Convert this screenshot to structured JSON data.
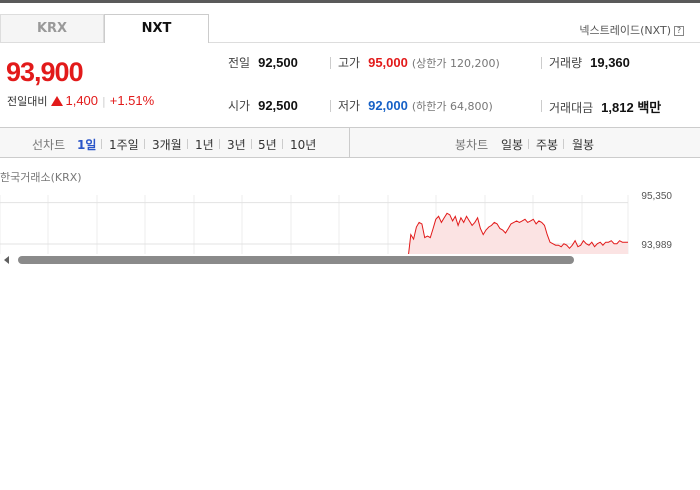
{
  "tabs": [
    {
      "label": "KRX",
      "active": false
    },
    {
      "label": "NXT",
      "active": true
    }
  ],
  "market_name": "넥스트레이드(NXT)",
  "help_glyph": "?",
  "price": "93,900",
  "change": {
    "label": "전일대비",
    "value": "1,400",
    "rate": "+1.51%",
    "direction": "up"
  },
  "stats": {
    "prev_close": {
      "label": "전일",
      "value": "92,500"
    },
    "high": {
      "label": "고가",
      "value": "95,000",
      "limit_text": "(상한가 120,200)"
    },
    "volume": {
      "label": "거래량",
      "value": "19,360"
    },
    "open": {
      "label": "시가",
      "value": "92,500"
    },
    "low": {
      "label": "저가",
      "value": "92,000",
      "limit_text": "(하한가 64,800)"
    },
    "amount": {
      "label": "거래대금",
      "value": "1,812 백만"
    }
  },
  "line_chart": {
    "label": "선차트",
    "periods": [
      {
        "label": "1일",
        "active": true
      },
      {
        "label": "1주일",
        "active": false
      },
      {
        "label": "3개월",
        "active": false
      },
      {
        "label": "1년",
        "active": false
      },
      {
        "label": "3년",
        "active": false
      },
      {
        "label": "5년",
        "active": false
      },
      {
        "label": "10년",
        "active": false
      }
    ]
  },
  "candle_chart": {
    "label": "봉차트",
    "periods": [
      {
        "label": "일봉",
        "active": false
      },
      {
        "label": "주봉",
        "active": false
      },
      {
        "label": "월봉",
        "active": false
      }
    ]
  },
  "chart_source": "한국거래소(KRX)",
  "chart_data": {
    "type": "line",
    "y_ticks": [
      "95,350",
      "93,989"
    ],
    "ylim": [
      93300,
      95600
    ],
    "line_color": "#e21a1a",
    "fill_color": "#fbe3e3",
    "values": [
      93500,
      94300,
      94150,
      94550,
      94700,
      94650,
      94200,
      94250,
      94200,
      94500,
      94800,
      94900,
      94700,
      94850,
      95000,
      94950,
      94750,
      94900,
      94600,
      94850,
      94700,
      94900,
      94750,
      94600,
      94700,
      94850,
      94500,
      94300,
      94450,
      94550,
      94600,
      94700,
      94650,
      94500,
      94450,
      94350,
      94500,
      94650,
      94700,
      94750,
      94700,
      94750,
      94800,
      94700,
      94750,
      94800,
      94650,
      94750,
      94700,
      94600,
      94300,
      94050,
      94000,
      93950,
      93950,
      93900,
      94000,
      93950,
      93850,
      93950,
      94100,
      93900,
      93950,
      94100,
      94000,
      93950,
      94050,
      93900,
      94000,
      94050,
      93950,
      94050,
      94050,
      94100,
      94000,
      94000,
      94100,
      94050,
      94050,
      94050
    ]
  },
  "colors": {
    "up": "#e21a1a",
    "down": "#1661c7",
    "active_period": "#2a55c8"
  }
}
